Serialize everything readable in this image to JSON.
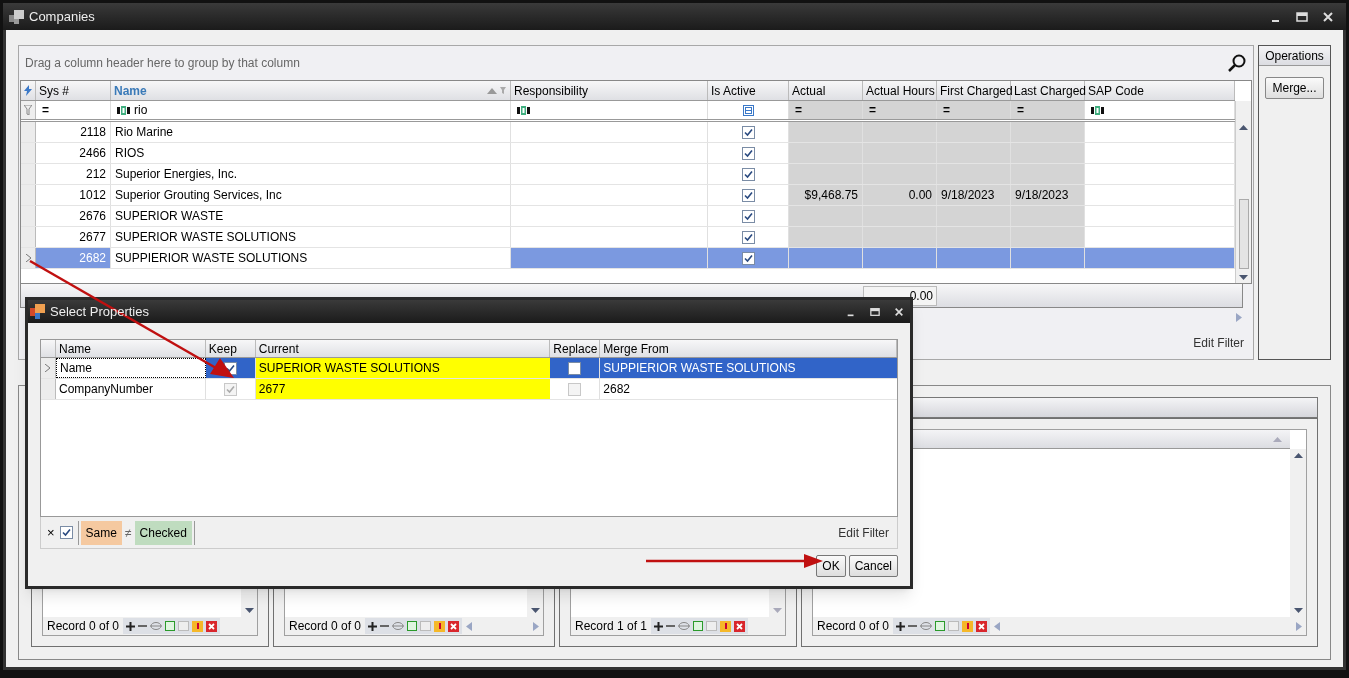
{
  "window": {
    "title": "Companies"
  },
  "grid": {
    "group_hint": "Drag a column header here to group by that column",
    "columns": [
      {
        "label": "Sys #",
        "sorted": false,
        "filter": {
          "kind": "operator",
          "text": "="
        }
      },
      {
        "label": "Name",
        "sorted": true,
        "filter": {
          "kind": "text",
          "value": "rio"
        }
      },
      {
        "label": "Responsibility",
        "sorted": false,
        "filter": {
          "kind": "text"
        }
      },
      {
        "label": "Is Active",
        "sorted": false,
        "filter": {
          "kind": "check"
        }
      },
      {
        "label": "Actual",
        "sorted": false,
        "filter": {
          "kind": "operator",
          "text": "="
        }
      },
      {
        "label": "Actual Hours",
        "sorted": false,
        "filter": {
          "kind": "operator",
          "text": "="
        }
      },
      {
        "label": "First Charged",
        "sorted": false,
        "filter": {
          "kind": "operator",
          "text": "="
        }
      },
      {
        "label": "Last Charged",
        "sorted": false,
        "filter": {
          "kind": "operator",
          "text": "="
        }
      },
      {
        "label": "SAP Code",
        "sorted": false,
        "filter": {
          "kind": "text"
        }
      }
    ],
    "rows": [
      {
        "sys": "2118",
        "name": "Rio Marine",
        "is_active": true,
        "selected": false
      },
      {
        "sys": "2466",
        "name": "RIOS",
        "is_active": true,
        "selected": false
      },
      {
        "sys": "212",
        "name": "Superior Energies, Inc.",
        "is_active": true,
        "selected": false
      },
      {
        "sys": "1012",
        "name": "Superior Grouting Services, Inc",
        "is_active": true,
        "actual": "$9,468.75",
        "actual_hours": "0.00",
        "first_charged": "9/18/2023",
        "last_charged": "9/18/2023",
        "selected": false
      },
      {
        "sys": "2676",
        "name": "SUPERIOR WASTE",
        "is_active": true,
        "selected": false
      },
      {
        "sys": "2677",
        "name": "SUPERIOR WASTE SOLUTIONS",
        "is_active": true,
        "selected": false
      },
      {
        "sys": "2682",
        "name": "SUPPIERIOR WASTE SOLUTIONS",
        "is_active": true,
        "selected": true
      }
    ],
    "footer": {
      "actual_hours": "0.00"
    },
    "edit_filter": "Edit Filter"
  },
  "operations": {
    "title": "Operations",
    "buttons": [
      "Merge..."
    ]
  },
  "panels": [
    {
      "record": "Record 0 of 0",
      "horizontal_scroll": false
    },
    {
      "record": "Record 0 of 0",
      "horizontal_scroll": true
    },
    {
      "record": "Record 1 of 1",
      "horizontal_scroll": false
    },
    {
      "record": "Record 0 of 0",
      "horizontal_scroll": true
    }
  ],
  "dialog": {
    "title": "Select Properties",
    "columns": [
      "Name",
      "Keep",
      "Current",
      "Replace",
      "Merge From"
    ],
    "rows": [
      {
        "name": "Name",
        "keep": true,
        "keep_disabled": false,
        "current": "SUPERIOR WASTE SOLUTIONS",
        "replace": false,
        "replace_disabled": false,
        "merge_from": "SUPPIERIOR WASTE SOLUTIONS",
        "selected": true
      },
      {
        "name": "CompanyNumber",
        "keep": true,
        "keep_disabled": true,
        "current": "2677",
        "replace": false,
        "replace_disabled": true,
        "merge_from": "2682",
        "selected": false
      }
    ],
    "filter": {
      "clear": "×",
      "enabled": true,
      "left": "Same",
      "operator": "≠",
      "right": "Checked"
    },
    "edit_filter": "Edit Filter",
    "buttons": [
      "OK",
      "Cancel"
    ]
  }
}
